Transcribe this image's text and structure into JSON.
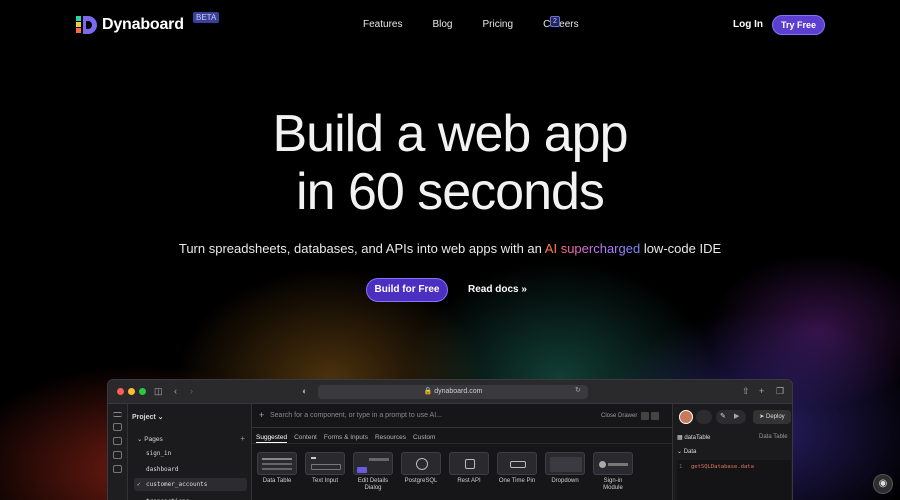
{
  "nav": {
    "brand": "Dynaboard",
    "beta": "BETA",
    "links": [
      "Features",
      "Blog",
      "Pricing",
      "Careers"
    ],
    "careers_badge": "2",
    "login": "Log In",
    "try_free": "Try Free"
  },
  "hero": {
    "line1": "Build a web app",
    "line2": "in 60 seconds",
    "sub_before": "Turn spreadsheets, databases, and APIs into web apps with an ",
    "sub_ai": "AI",
    "sub_super": "supercharged",
    "sub_after": " low-code IDE",
    "build_btn": "Build for Free",
    "docs_link": "Read docs »"
  },
  "app": {
    "url": "dynaboard.com",
    "project": "Project ⌄",
    "pages_label": "Pages",
    "pages": [
      "sign_in",
      "dashboard",
      "customer_accounts",
      "transactions"
    ],
    "search_placeholder": "Search for a component, or type in a prompt to use AI...",
    "close_drawer": "Close Drawer",
    "tabs": [
      "Suggested",
      "Content",
      "Forms & Inputs",
      "Resources",
      "Custom"
    ],
    "components": [
      "Data Table",
      "Text Input",
      "Edit Details Dialog",
      "PostgreSQL",
      "Rest API",
      "One Time Pin",
      "Dropdown",
      "Sign-in Module"
    ],
    "deploy": "Deploy",
    "inspector_name": "dataTable",
    "inspector_type": "Data Table",
    "data_label": "Data",
    "code_line_no": "1",
    "code": "getSQLDatabase.data"
  },
  "colors": {
    "accent": "#5b3fd0",
    "accent_border": "#8a72ff"
  }
}
